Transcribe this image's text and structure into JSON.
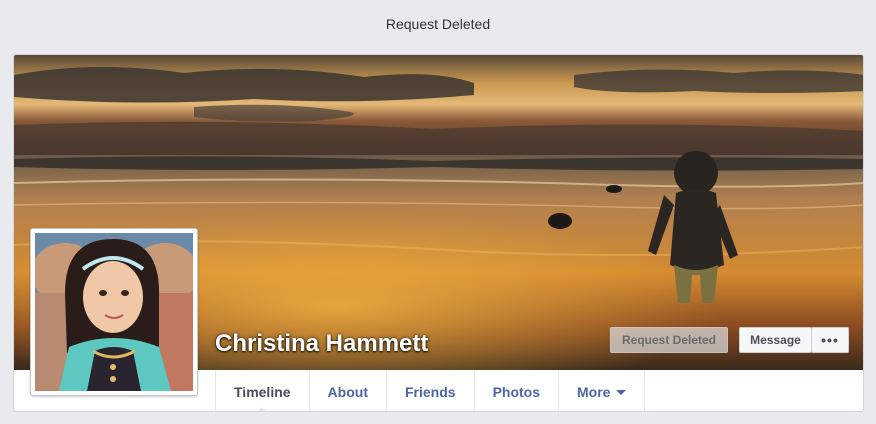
{
  "status_text": "Request Deleted",
  "profile": {
    "name": "Christina Hammett",
    "request_button": "Request Deleted",
    "message_button": "Message",
    "more_actions_icon": "ellipsis-icon",
    "more_actions_label": "•••"
  },
  "tabs": [
    {
      "label": "Timeline",
      "active": true
    },
    {
      "label": "About"
    },
    {
      "label": "Friends"
    },
    {
      "label": "Photos"
    },
    {
      "label": "More"
    }
  ],
  "colors": {
    "page_background": "#e9eaed",
    "link_blue": "#4b67a1",
    "text_dark": "#4b4f56"
  }
}
